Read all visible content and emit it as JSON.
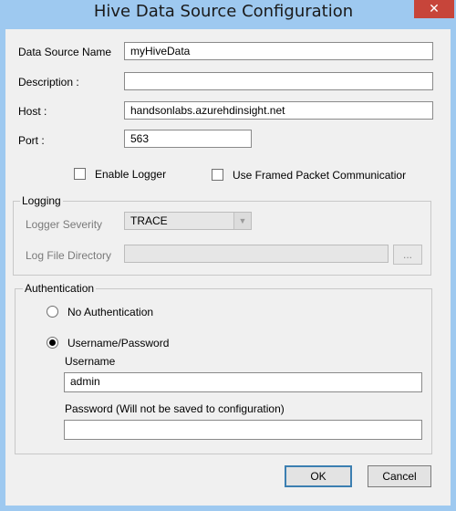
{
  "window": {
    "title": "Hive Data Source Configuration",
    "close_glyph": "✕"
  },
  "fields": {
    "data_source_name": {
      "label": "Data Source Name",
      "value": "myHiveData"
    },
    "description": {
      "label": "Description :",
      "value": ""
    },
    "host": {
      "label": "Host :",
      "value": "handsonlabs.azurehdinsight.net"
    },
    "port": {
      "label": "Port :",
      "value": "563"
    }
  },
  "options": {
    "enable_logger": {
      "label": "Enable Logger",
      "checked": false
    },
    "framed_packet": {
      "label": "Use Framed Packet Communicatior",
      "checked": false
    }
  },
  "logging": {
    "legend": "Logging",
    "severity_label": "Logger Severity",
    "severity_value": "TRACE",
    "log_dir_label": "Log File Directory",
    "log_dir_value": "",
    "browse_label": "..."
  },
  "authentication": {
    "legend": "Authentication",
    "no_auth_label": "No Authentication",
    "userpass_label": "Username/Password",
    "selected": "userpass",
    "username_label": "Username",
    "username_value": "admin",
    "password_label": "Password (Will not be saved to configuration)",
    "password_value": ""
  },
  "buttons": {
    "ok": "OK",
    "cancel": "Cancel"
  },
  "icons": {
    "close": "close-icon",
    "dropdown": "chevron-down-icon",
    "radio_selected": "radio-dot-icon"
  }
}
